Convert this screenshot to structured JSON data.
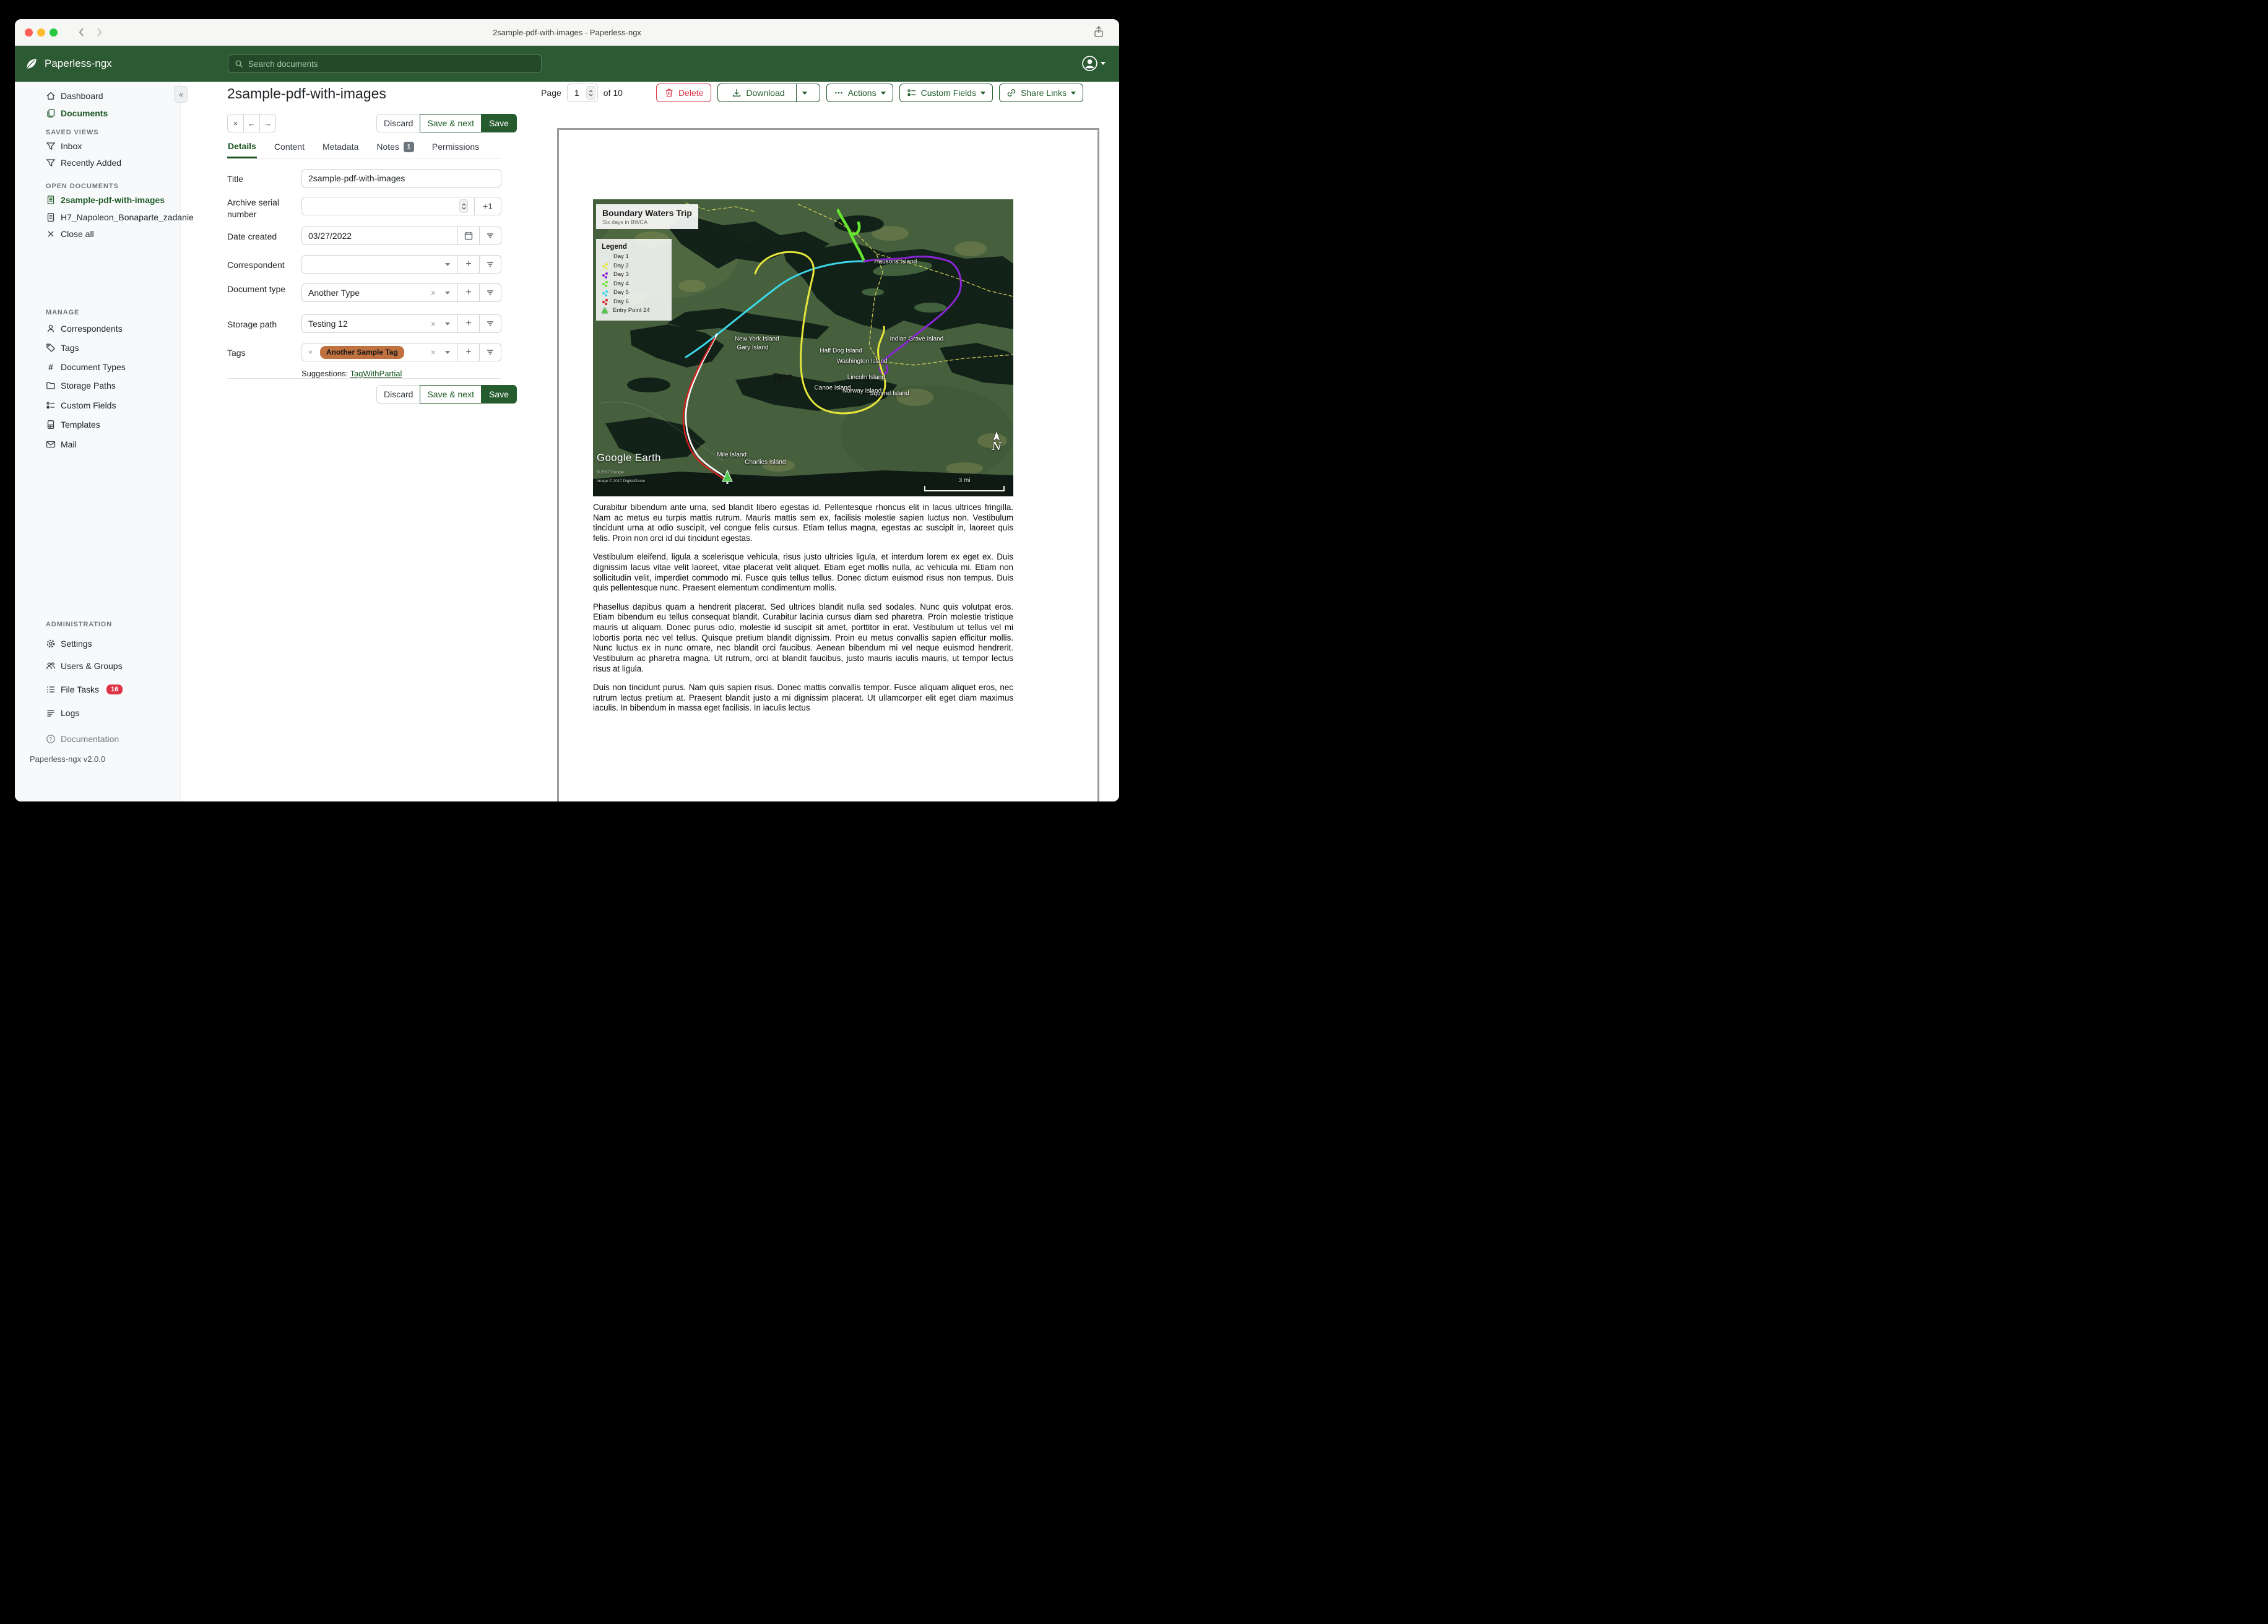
{
  "colors": {
    "header_green": "#2c5a33",
    "accent_green": "#1f5b29",
    "danger_red": "#dc3545",
    "tag_chip_orange": "#bf7140",
    "badge_gray": "#6c757d",
    "traffic_lights": [
      "#ff5f57",
      "#febc2e",
      "#28c840"
    ]
  },
  "titlebar": {
    "title": "2sample-pdf-with-images - Paperless-ngx"
  },
  "header": {
    "app_name": "Paperless-ngx",
    "search_placeholder": "Search documents"
  },
  "sidebar": {
    "dashboard": "Dashboard",
    "documents": "Documents",
    "saved_views_title": "SAVED VIEWS",
    "inbox": "Inbox",
    "recently_added": "Recently Added",
    "open_documents_title": "OPEN DOCUMENTS",
    "open_doc_1": "2sample-pdf-with-images",
    "open_doc_2": "H7_Napoleon_Bonaparte_zadanie",
    "close_all": "Close all",
    "manage_title": "MANAGE",
    "correspondents": "Correspondents",
    "tags": "Tags",
    "document_types": "Document Types",
    "storage_paths": "Storage Paths",
    "custom_fields": "Custom Fields",
    "templates": "Templates",
    "mail": "Mail",
    "admin_title": "ADMINISTRATION",
    "settings": "Settings",
    "users_groups": "Users & Groups",
    "file_tasks": "File Tasks",
    "file_tasks_badge": "16",
    "logs": "Logs",
    "documentation": "Documentation",
    "version": "Paperless-ngx v2.0.0"
  },
  "toolbar": {
    "page_label": "Page",
    "page_value": "1",
    "page_total": "of 10",
    "delete_label": "Delete",
    "download_label": "Download",
    "actions_label": "Actions",
    "custom_fields_label": "Custom Fields",
    "share_links_label": "Share Links"
  },
  "document": {
    "title": "2sample-pdf-with-images",
    "discard_label": "Discard",
    "save_next_label": "Save & next",
    "save_label": "Save",
    "tabs": {
      "details": "Details",
      "content": "Content",
      "metadata": "Metadata",
      "notes": "Notes",
      "notes_badge": "1",
      "permissions": "Permissions"
    },
    "fields": {
      "title_label": "Title",
      "title_value": "2sample-pdf-with-images",
      "asn_label": "Archive serial number",
      "asn_value": "",
      "asn_increment": "+1",
      "date_label": "Date created",
      "date_value": "03/27/2022",
      "correspondent_label": "Correspondent",
      "correspondent_value": "",
      "doctype_label": "Document type",
      "doctype_value": "Another Type",
      "storage_label": "Storage path",
      "storage_value": "Testing 12",
      "tags_label": "Tags",
      "tag_chip": "Another Sample Tag",
      "suggestions_label": "Suggestions:",
      "suggestion_link": "TagWithPartial"
    }
  },
  "preview": {
    "map": {
      "title": "Boundary Waters Trip",
      "subtitle": "Six days in BWCA",
      "legend_title": "Legend",
      "legend": [
        {
          "label": "Day 1",
          "color": "#d8eee8"
        },
        {
          "label": "Day 2",
          "color": "#e6e63c"
        },
        {
          "label": "Day 3",
          "color": "#8b25d6"
        },
        {
          "label": "Day 4",
          "color": "#66e62e"
        },
        {
          "label": "Day 5",
          "color": "#3cd8e8"
        },
        {
          "label": "Day 6",
          "color": "#d62020"
        },
        {
          "label": "Entry Point 24",
          "color": "#52c94f"
        }
      ],
      "labels": [
        {
          "text": "New York Island"
        },
        {
          "text": "Gary Island"
        },
        {
          "text": "Hausons Island"
        },
        {
          "text": "Indian Grave Island"
        },
        {
          "text": "Half Dog Island"
        },
        {
          "text": "Washington Island"
        },
        {
          "text": "Lincoln Island"
        },
        {
          "text": "Canoe Island"
        },
        {
          "text": "Norway Island"
        },
        {
          "text": "Squirrel Island"
        },
        {
          "text": "Mile Island"
        },
        {
          "text": "Charlies Island"
        }
      ],
      "text_label": "Text",
      "google_logo": "Google Earth",
      "attr1": "© 2017 Google",
      "attr2": "Image © 2017 DigitalGlobe",
      "scale_label": "3 mi",
      "north_label": "N"
    },
    "paragraphs": [
      "Curabitur bibendum ante urna, sed blandit libero egestas id. Pellentesque rhoncus elit in lacus ultrices fringilla. Nam ac metus eu turpis mattis rutrum. Mauris mattis sem ex, facilisis molestie sapien luctus non. Vestibulum tincidunt urna at odio suscipit, vel congue felis cursus. Etiam tellus magna, egestas ac suscipit in, laoreet quis felis. Proin non orci id dui tincidunt egestas.",
      "Vestibulum eleifend, ligula a scelerisque vehicula, risus justo ultricies ligula, et interdum lorem ex eget ex. Duis dignissim lacus vitae velit laoreet, vitae placerat velit aliquet. Etiam eget mollis nulla, ac vehicula mi. Etiam non sollicitudin velit, imperdiet commodo mi. Fusce quis tellus tellus. Donec dictum euismod risus non tempus. Duis quis pellentesque nunc. Praesent elementum condimentum mollis.",
      "Phasellus dapibus quam a hendrerit placerat. Sed ultrices blandit nulla sed sodales. Nunc quis volutpat eros. Etiam bibendum eu tellus consequat blandit. Curabitur lacinia cursus diam sed pharetra. Proin molestie tristique mauris ut aliquam. Donec purus odio, molestie id suscipit sit amet, porttitor in erat. Vestibulum ut tellus vel mi lobortis porta nec vel tellus. Quisque pretium blandit dignissim. Proin eu metus convallis sapien efficitur mollis. Nunc luctus ex in nunc ornare, nec blandit orci faucibus. Aenean bibendum mi vel neque euismod hendrerit. Vestibulum ac pharetra magna. Ut rutrum, orci at blandit faucibus, justo mauris iaculis mauris, ut tempor lectus risus at ligula.",
      "Duis non tincidunt purus. Nam quis sapien risus. Donec mattis convallis tempor. Fusce aliquam aliquet eros, nec rutrum lectus pretium at. Praesent blandit justo a mi dignissim placerat. Ut ullamcorper elit eget diam maximus iaculis. In bibendum in massa eget facilisis. In iaculis lectus"
    ]
  }
}
